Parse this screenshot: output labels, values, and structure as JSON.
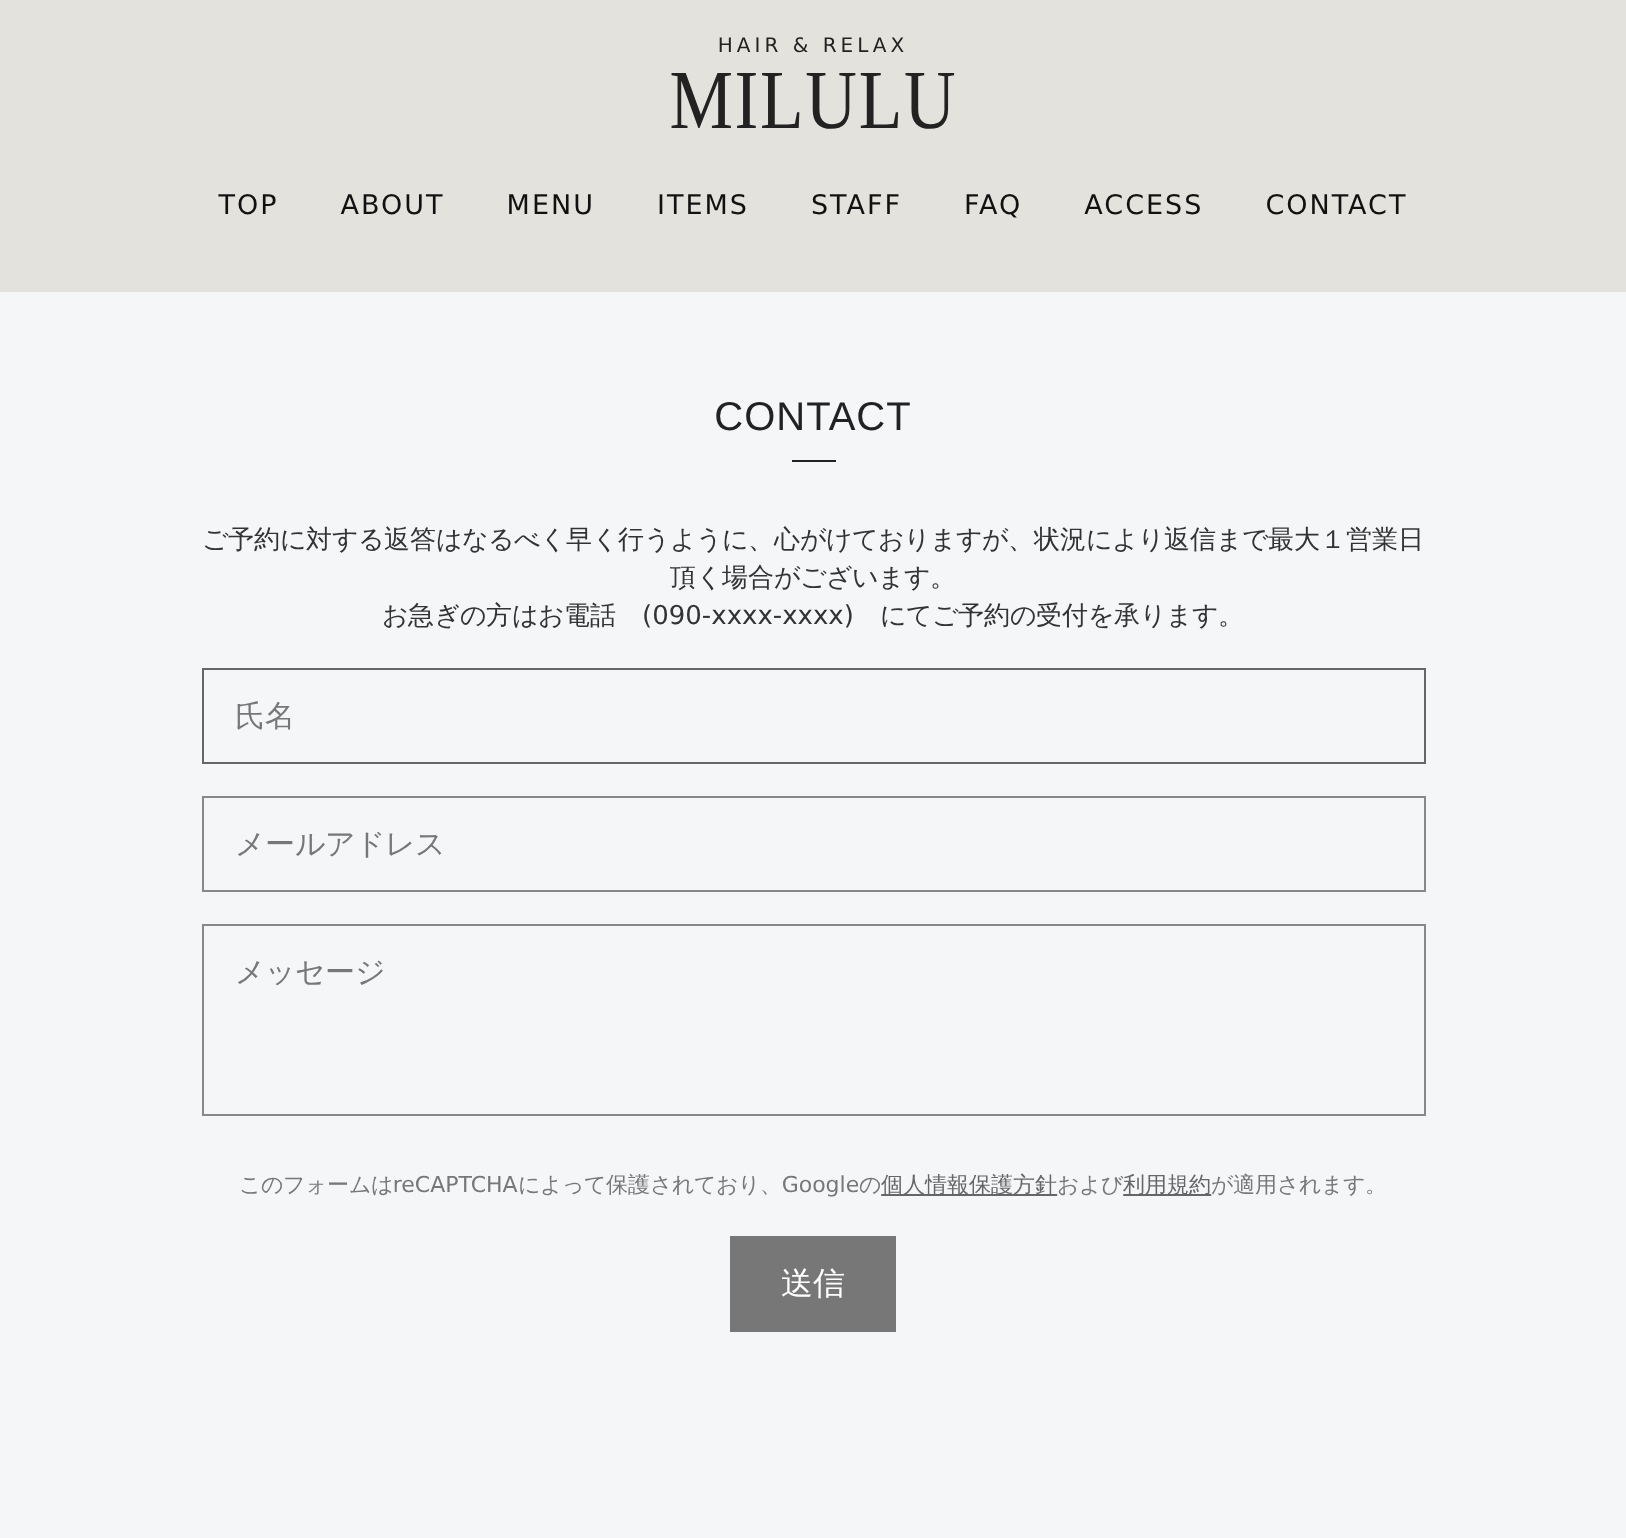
{
  "header": {
    "tagline": "HAIR & RELAX",
    "logo": "MILULU"
  },
  "nav": [
    {
      "label": "TOP"
    },
    {
      "label": "ABOUT"
    },
    {
      "label": "MENU"
    },
    {
      "label": "ITEMS"
    },
    {
      "label": "STAFF"
    },
    {
      "label": "FAQ"
    },
    {
      "label": "ACCESS"
    },
    {
      "label": "CONTACT"
    }
  ],
  "contact": {
    "title": "CONTACT",
    "intro": [
      "ご予約に対する返答はなるべく早く行うように、心がけておりますが、状況により返信まで最大１営業日頂く場合がございます。",
      "お急ぎの方はお電話　(090-xxxx-xxxx)　にてご予約の受付を承ります。"
    ],
    "fields": [
      {
        "kind": "input",
        "placeholder": "氏名",
        "focused": true
      },
      {
        "kind": "input",
        "placeholder": "メールアドレス",
        "focused": false
      },
      {
        "kind": "textarea",
        "placeholder": "メッセージ",
        "focused": false
      }
    ],
    "notice": [
      {
        "kind": "text",
        "text": "このフォームはreCAPTCHAによって保護されており、Googleの"
      },
      {
        "kind": "link",
        "text": "個人情報保護方針"
      },
      {
        "kind": "text",
        "text": "および"
      },
      {
        "kind": "link",
        "text": "利用規約"
      },
      {
        "kind": "text",
        "text": "が適用されます。"
      }
    ],
    "submit": "送信"
  }
}
